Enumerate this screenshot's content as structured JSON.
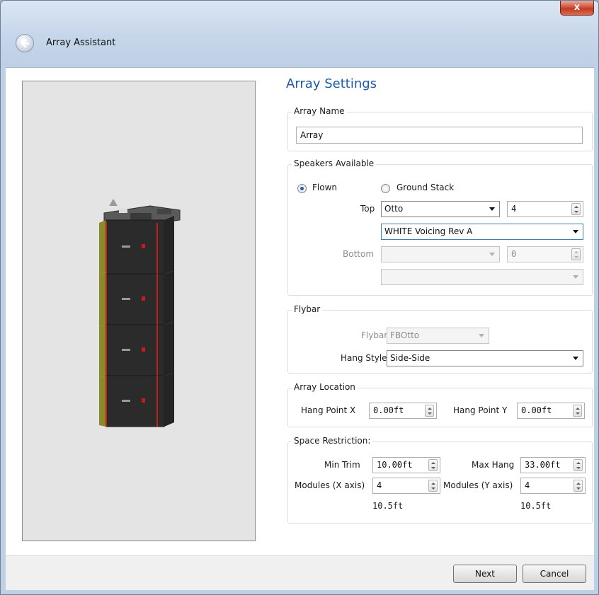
{
  "window": {
    "title": "Array Assistant",
    "close_glyph": "x"
  },
  "heading": "Array Settings",
  "array_name": {
    "title": "Array Name",
    "value": "Array"
  },
  "speakers": {
    "title": "Speakers Available",
    "flown_label": "Flown",
    "ground_stack_label": "Ground Stack",
    "mode_selected": "Flown",
    "top_label": "Top",
    "top_model": "Otto",
    "top_count": "4",
    "top_voicing": "WHITE Voicing Rev A",
    "bottom_label": "Bottom",
    "bottom_model": "",
    "bottom_count": "0",
    "bottom_voicing": ""
  },
  "flybar": {
    "title": "Flybar",
    "flybar_label": "Flybar",
    "flybar_value": "FBOtto",
    "hang_style_label": "Hang Style",
    "hang_style_value": "Side-Side"
  },
  "location": {
    "title": "Array Location",
    "hang_x_label": "Hang Point X",
    "hang_x_value": "0.00ft",
    "hang_y_label": "Hang Point Y",
    "hang_y_value": "0.00ft"
  },
  "restriction": {
    "title": "Space Restriction:",
    "min_trim_label": "Min Trim",
    "min_trim_value": "10.00ft",
    "max_hang_label": "Max Hang",
    "max_hang_value": "33.00ft",
    "modules_x_label": "Modules (X axis)",
    "modules_x_value": "4",
    "modules_y_label": "Modules (Y axis)",
    "modules_y_value": "4",
    "size_x": "10.5ft",
    "size_y": "10.5ft"
  },
  "footer": {
    "next_label": "Next",
    "cancel_label": "Cancel"
  },
  "preview": {
    "module_count": 4
  },
  "colors": {
    "heading": "#1e5aa8",
    "module_body": "#2a2a2a",
    "module_side": "#8a8a2a",
    "accent_red": "#c0201c"
  }
}
